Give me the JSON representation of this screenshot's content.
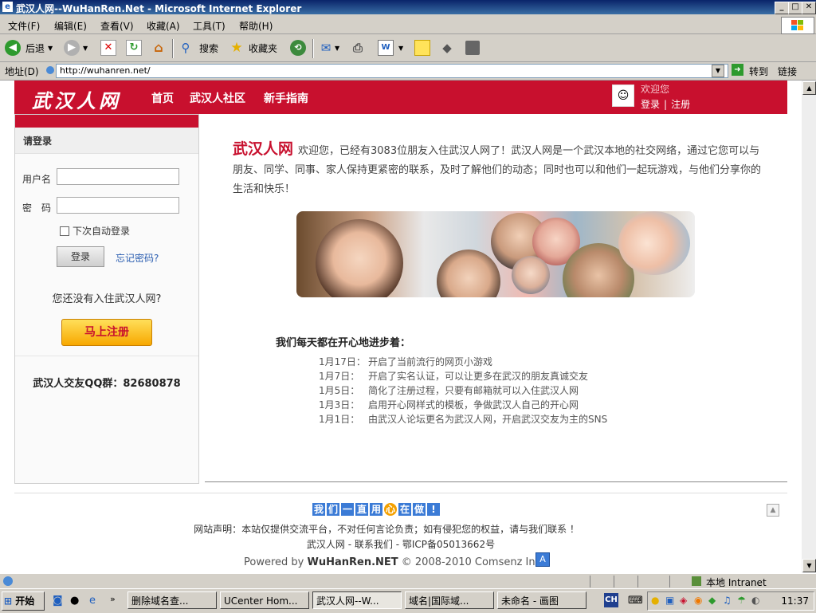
{
  "window": {
    "title": "武汉人网--WuHanRen.Net - Microsoft Internet Explorer"
  },
  "menu": [
    "文件(F)",
    "编辑(E)",
    "查看(V)",
    "收藏(A)",
    "工具(T)",
    "帮助(H)"
  ],
  "toolbar": {
    "back": "后退",
    "search": "搜索",
    "favorites": "收藏夹"
  },
  "address": {
    "label": "地址(D)",
    "url": "http://wuhanren.net/",
    "go": "转到",
    "links": "链接"
  },
  "site": {
    "logo": "武汉人网",
    "nav": [
      "首页",
      "武汉人社区",
      "新手指南"
    ],
    "welcome": "欢迎您",
    "login_link": "登录",
    "register_link": "注册"
  },
  "login": {
    "heading": "请登录",
    "username_label": "用户名",
    "password_label": "密　码",
    "remember": "下次自动登录",
    "submit": "登录",
    "forgot": "忘记密码?",
    "no_account": "您还没有入住武汉人网?",
    "register_btn": "马上注册",
    "qq_group": "武汉人交友QQ群：82680878"
  },
  "intro": {
    "brand": "武汉人网",
    "text": "欢迎您，已经有3083位朋友入住武汉人网了！武汉人网是一个武汉本地的社交网络，通过它您可以与朋友、同学、同事、家人保持更紧密的联系，及时了解他们的动态；同时也可以和他们一起玩游戏，与他们分享你的生活和快乐！"
  },
  "updates": {
    "title": "我们每天都在开心地进步着：",
    "items": [
      {
        "date": "1月17日：",
        "text": "开启了当前流行的网页小游戏"
      },
      {
        "date": "1月7日：",
        "text": "开启了实名认证，可以让更多在武汉的朋友真诚交友"
      },
      {
        "date": "1月5日：",
        "text": "简化了注册过程，只要有邮箱就可以入住武汉人网"
      },
      {
        "date": "1月3日：",
        "text": "启用开心网样式的模板，争做武汉人自己的开心网"
      },
      {
        "date": "1月1日：",
        "text": "由武汉人论坛更名为武汉人网，开启武汉交友为主的SNS"
      }
    ]
  },
  "footer": {
    "slogan": [
      "我",
      "们",
      "一",
      "直",
      "用",
      "心",
      "在",
      "做",
      "!"
    ],
    "disclaimer": "网站声明：本站仅提供交流平台，不对任何言论负责；如有侵犯您的权益，请与我们联系 ！",
    "contact": "武汉人网 - 联系我们 - 鄂ICP备05013662号",
    "powered_prefix": "Powered by ",
    "powered_brand": "WuHanRen.NET",
    "powered_suffix": " © 2008-2010 Comsenz Inc.",
    "a_icon": "A"
  },
  "status": {
    "zone": "本地 Intranet"
  },
  "taskbar": {
    "start": "开始",
    "tasks": [
      "删除域名查...",
      "UCenter Hom...",
      "武汉人网--W...",
      "域名|国际域...",
      "未命名 - 画图"
    ],
    "ime": "CH",
    "clock": "11:37"
  },
  "colors": {
    "brand_red": "#c8102e",
    "link_blue": "#2a5db0",
    "register_yellow": "#f7a800"
  }
}
